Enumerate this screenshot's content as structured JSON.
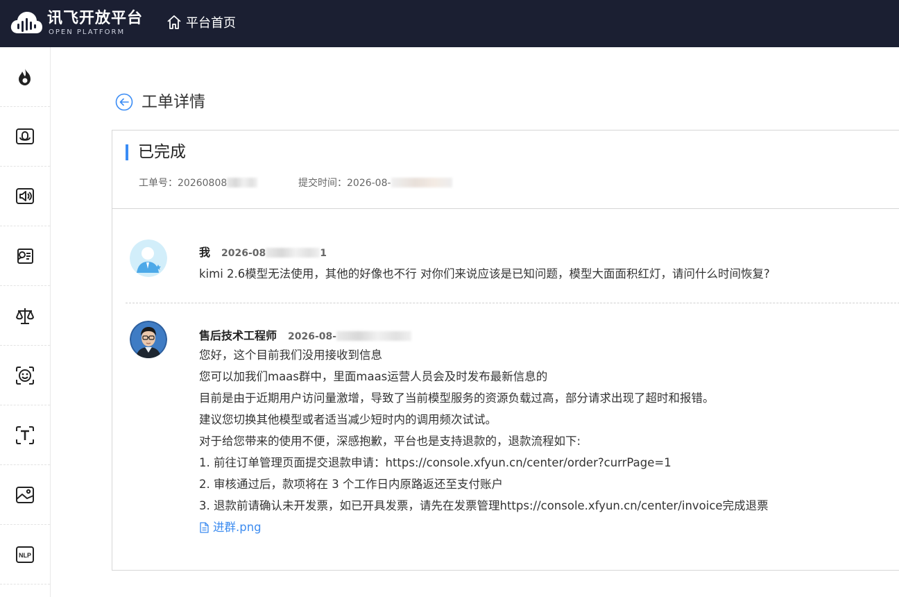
{
  "header": {
    "logo_cn": "讯飞开放平台",
    "logo_en": "OPEN PLATFORM",
    "home_label": "平台首页"
  },
  "sidebar": {
    "items": [
      {
        "icon": "flame-icon"
      },
      {
        "icon": "microphone-icon"
      },
      {
        "icon": "speaker-icon"
      },
      {
        "icon": "voice-doc-icon"
      },
      {
        "icon": "scale-icon"
      },
      {
        "icon": "face-scan-icon"
      },
      {
        "icon": "text-scan-icon"
      },
      {
        "icon": "image-icon"
      },
      {
        "icon": "nlp-icon"
      }
    ],
    "nlp_label": "NLP"
  },
  "page": {
    "title": "工单详情"
  },
  "ticket": {
    "status": "已完成",
    "id_label": "工单号：",
    "id_value": "20260808",
    "submit_label": "提交时间：",
    "submit_value": "2026-08-"
  },
  "messages": [
    {
      "name": "我",
      "time": "2026-08",
      "time_tail": "1",
      "lines": [
        "kimi 2.6模型无法使用，其他的好像也不行 对你们来说应该是已知问题，模型大面面积红灯，请问什么时间恢复?"
      ]
    },
    {
      "name": "售后技术工程师",
      "time": "2026-08-",
      "lines": [
        "您好，这个目前我们没用接收到信息",
        "您可以加我们maas群中，里面maas运营人员会及时发布最新信息的",
        "目前是由于近期用户访问量激增，导致了当前模型服务的资源负载过高，部分请求出现了超时和报错。",
        "建议您切换其他模型或者适当减少短时内的调用频次试试。",
        "对于给您带来的使用不便，深感抱歉，平台也是支持退款的，退款流程如下:",
        "1. 前往订单管理页面提交退款申请：https://console.xfyun.cn/center/order?currPage=1",
        "2. 审核通过后，款项将在 3 个工作日内原路返还至支付账户",
        "3. 退款前请确认未开发票，如已开具发票，请先在发票管理https://console.xfyun.cn/center/invoice完成退票"
      ],
      "attachment": "进群.png"
    }
  ],
  "colors": {
    "topbar": "#1b1f32",
    "accent": "#3a8cf5",
    "link": "#3d8cf0"
  }
}
